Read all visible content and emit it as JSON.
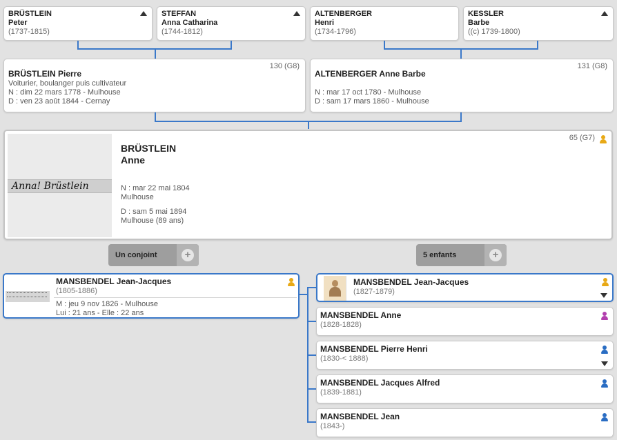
{
  "grandparents": [
    {
      "last": "BRÜSTLEIN",
      "first": "Peter",
      "dates": "(1737-1815)"
    },
    {
      "last": "STEFFAN",
      "first": "Anna Catharina",
      "dates": "(1744-1812)"
    },
    {
      "last": "ALTENBERGER",
      "first": "Henri",
      "dates": "(1734-1796)"
    },
    {
      "last": "KESSLER",
      "first": "Barbe",
      "dates": "((c) 1739-1800)"
    }
  ],
  "father": {
    "name": "BRÜSTLEIN Pierre",
    "sosa": "130 (G8)",
    "occupation": "Voiturier, boulanger puis cultivateur",
    "birth": "N : dim 22 mars 1778 - Mulhouse",
    "death": "D : ven 23 août 1844 - Cernay"
  },
  "mother": {
    "name": "ALTENBERGER Anne Barbe",
    "sosa": "131 (G8)",
    "birth": "N : mar 17 oct 1780 - Mulhouse",
    "death": "D : sam 17 mars 1860 - Mulhouse"
  },
  "subject": {
    "last": "BRÜSTLEIN",
    "first": "Anne",
    "sosa": "65 (G7)",
    "signature": "Anna! Brüstlein",
    "birth_line1": "N : mar 22 mai 1804",
    "birth_line2": "Mulhouse",
    "death_line1": "D : sam 5 mai 1894",
    "death_line2": "Mulhouse (89 ans)"
  },
  "spouse_pill": {
    "label": "Un conjoint"
  },
  "children_pill": {
    "label": "5 enfants"
  },
  "spouse": {
    "name": "MANSBENDEL Jean-Jacques",
    "dates": "(1805-1886)",
    "marriage": "M : jeu 9 nov 1826 - Mulhouse",
    "ages": "Lui : 21 ans - Elle : 22 ans"
  },
  "children": [
    {
      "name": "MANSBENDEL Jean-Jacques",
      "dates": "(1827-1879)"
    },
    {
      "name": "MANSBENDEL Anne",
      "dates": "(1828-1828)"
    },
    {
      "name": "MANSBENDEL Pierre Henri",
      "dates": "(1830-< 1888)"
    },
    {
      "name": "MANSBENDEL Jacques Alfred",
      "dates": "(1839-1881)"
    },
    {
      "name": "MANSBENDEL Jean",
      "dates": "(1843-)"
    }
  ],
  "colors": {
    "accent": "#3a78c9",
    "male": "#2a6dc3",
    "female": "#b23fae",
    "sosa": "#e8a916"
  }
}
